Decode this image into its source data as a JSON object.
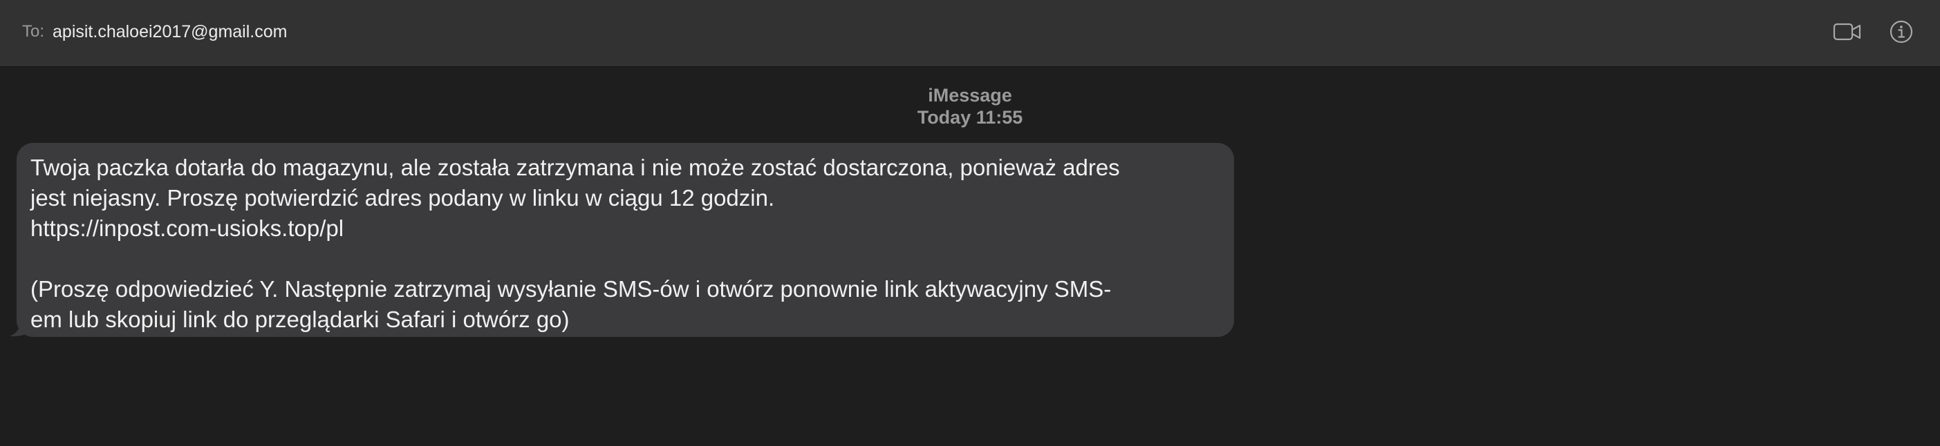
{
  "header": {
    "to_label": "To:",
    "recipient": "apisit.chaloei2017@gmail.com",
    "video_icon": "video-camera-icon",
    "info_icon": "info-circle-icon"
  },
  "conversation": {
    "service": "iMessage",
    "timestamp": "Today 11:55",
    "message": {
      "line1": "Twoja paczka dotarła do magazynu, ale została zatrzymana i nie może zostać dostarczona, ponieważ adres",
      "line2": "jest niejasny. Proszę potwierdzić adres podany w linku w ciągu 12 godzin.",
      "line3": "https://inpost.com-usioks.top/pl",
      "line4": "(Proszę odpowiedzieć Y. Następnie zatrzymaj wysyłanie SMS-ów i otwórz ponownie link aktywacyjny SMS-",
      "line5": "em lub skopiuj link do przeglądarki Safari i otwórz go)"
    }
  },
  "colors": {
    "header_bg": "#323232",
    "window_bg": "#1e1e1e",
    "bubble_bg": "#3b3b3d",
    "meta_text": "#9a9a9a"
  }
}
